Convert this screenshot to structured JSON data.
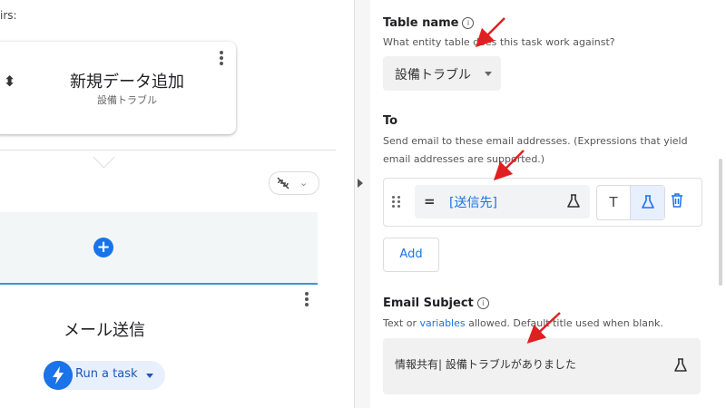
{
  "left": {
    "top_label": "irs:",
    "card": {
      "title": "新規データ追加",
      "subtitle": "設備トラブル"
    },
    "step_title": "メール送信",
    "run_chip_label": "Run a task"
  },
  "right": {
    "table_name": {
      "label": "Table name",
      "help": "What entity table does this task work against?",
      "value": "設備トラブル"
    },
    "to": {
      "label": "To",
      "help_line1": "Send email to these email addresses. (Expressions that yield",
      "help_line2": "email addresses are supported.)",
      "operator": "=",
      "expression": "[送信先]",
      "add_label": "Add"
    },
    "email_subject": {
      "label": "Email Subject",
      "help_prefix": "Text or ",
      "help_link": "variables",
      "help_suffix": " allowed. Default title used when blank.",
      "value": "情報共有| 設備トラブルがありました"
    }
  },
  "colors": {
    "accent": "#1a73e8",
    "annotation": "#e02020"
  },
  "icons": [
    "drag-icon",
    "more-vert-icon",
    "link-off-icon",
    "add-circle-icon",
    "bolt-icon",
    "info-icon",
    "flask-icon",
    "text-icon",
    "delete-icon",
    "expand-icon"
  ]
}
